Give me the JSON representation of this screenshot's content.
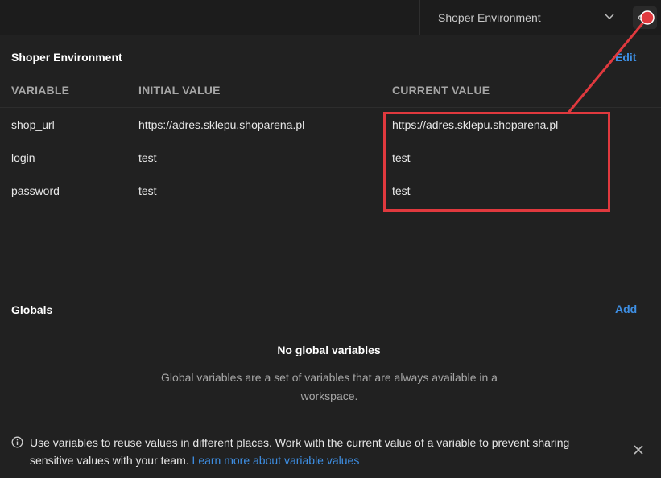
{
  "header": {
    "environment_selected": "Shoper Environment"
  },
  "environment": {
    "title": "Shoper Environment",
    "edit_label": "Edit",
    "columns": [
      "VARIABLE",
      "INITIAL VALUE",
      "CURRENT VALUE"
    ],
    "rows": [
      {
        "variable": "shop_url",
        "initial": "https://adres.sklepu.shoparena.pl",
        "current": "https://adres.sklepu.shoparena.pl"
      },
      {
        "variable": "login",
        "initial": "test",
        "current": "test"
      },
      {
        "variable": "password",
        "initial": "test",
        "current": "test"
      }
    ]
  },
  "globals": {
    "title": "Globals",
    "add_label": "Add",
    "empty_title": "No global variables",
    "empty_description": "Global variables are a set of variables that are always available in a workspace."
  },
  "info": {
    "text": "Use variables to reuse values in different places. Work with the current value of a variable to prevent sharing sensitive values with your team.",
    "link": "Learn more about variable values"
  },
  "colors": {
    "background": "#212121",
    "accent_link": "#3e8fe4",
    "annotation": "#e0393e"
  },
  "icons": [
    "chevron-down-icon",
    "eye-icon",
    "info-icon",
    "close-icon"
  ]
}
